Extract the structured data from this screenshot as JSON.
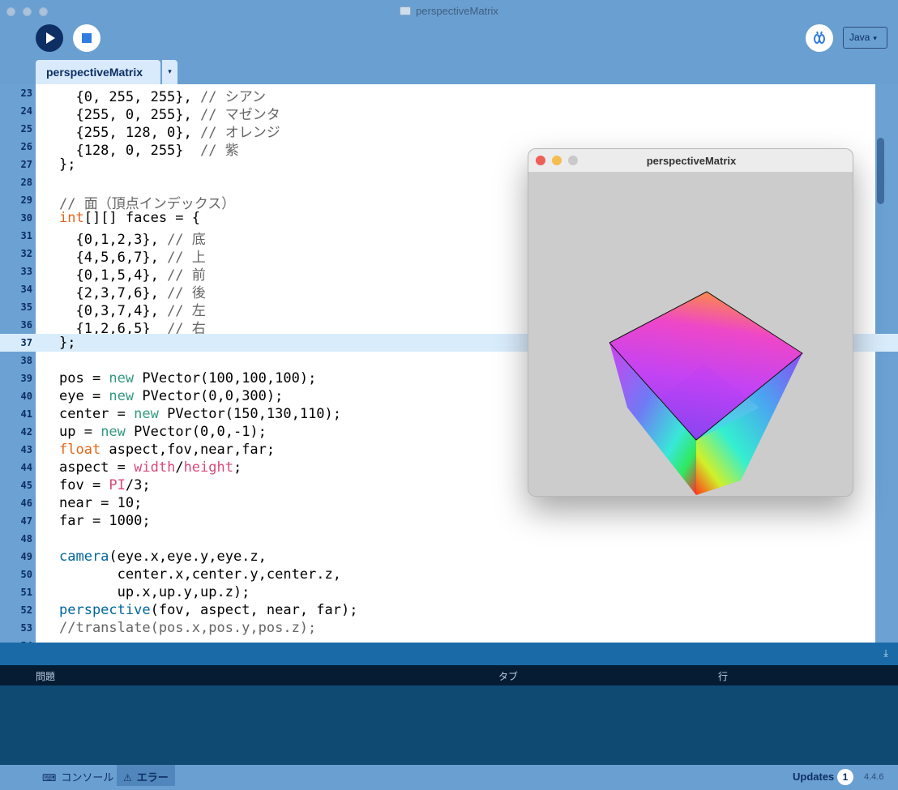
{
  "window": {
    "title": "perspectiveMatrix"
  },
  "toolbar": {
    "run_icon": "play-icon",
    "stop_icon": "stop-icon",
    "debug_icon": "debugger-icon",
    "mode": "Java",
    "mode_arrow": "▾"
  },
  "tabs": [
    {
      "label": "perspectiveMatrix",
      "menu": "▾"
    }
  ],
  "editor": {
    "current_line": "37",
    "lines": [
      {
        "n": "23",
        "segs": [
          {
            "t": "  {0, 255, 255}, ",
            "c": ""
          },
          {
            "t": "// シアン",
            "c": "k-com"
          }
        ]
      },
      {
        "n": "24",
        "segs": [
          {
            "t": "  {255, 0, 255}, ",
            "c": ""
          },
          {
            "t": "// マゼンタ",
            "c": "k-com"
          }
        ]
      },
      {
        "n": "25",
        "segs": [
          {
            "t": "  {255, 128, 0}, ",
            "c": ""
          },
          {
            "t": "// オレンジ",
            "c": "k-com"
          }
        ]
      },
      {
        "n": "26",
        "segs": [
          {
            "t": "  {128, 0, 255}  ",
            "c": ""
          },
          {
            "t": "// 紫",
            "c": "k-com"
          }
        ]
      },
      {
        "n": "27",
        "segs": [
          {
            "t": "};",
            "c": ""
          }
        ]
      },
      {
        "n": "28",
        "segs": []
      },
      {
        "n": "29",
        "segs": [
          {
            "t": "// 面（頂点インデックス）",
            "c": "k-com"
          }
        ]
      },
      {
        "n": "30",
        "segs": [
          {
            "t": "int",
            "c": "k-type"
          },
          {
            "t": "[][] faces = {",
            "c": ""
          }
        ]
      },
      {
        "n": "31",
        "segs": [
          {
            "t": "  {0,1,2,3}, ",
            "c": ""
          },
          {
            "t": "// 底",
            "c": "k-com"
          }
        ]
      },
      {
        "n": "32",
        "segs": [
          {
            "t": "  {4,5,6,7}, ",
            "c": ""
          },
          {
            "t": "// 上",
            "c": "k-com"
          }
        ]
      },
      {
        "n": "33",
        "segs": [
          {
            "t": "  {0,1,5,4}, ",
            "c": ""
          },
          {
            "t": "// 前",
            "c": "k-com"
          }
        ]
      },
      {
        "n": "34",
        "segs": [
          {
            "t": "  {2,3,7,6}, ",
            "c": ""
          },
          {
            "t": "// 後",
            "c": "k-com"
          }
        ]
      },
      {
        "n": "35",
        "segs": [
          {
            "t": "  {0,3,7,4}, ",
            "c": ""
          },
          {
            "t": "// 左",
            "c": "k-com"
          }
        ]
      },
      {
        "n": "36",
        "segs": [
          {
            "t": "  {1,2,6,5}  ",
            "c": ""
          },
          {
            "t": "// 右",
            "c": "k-com"
          }
        ]
      },
      {
        "n": "37",
        "segs": [
          {
            "t": "};",
            "c": ""
          }
        ]
      },
      {
        "n": "38",
        "segs": []
      },
      {
        "n": "39",
        "segs": [
          {
            "t": "pos = ",
            "c": ""
          },
          {
            "t": "new",
            "c": "k-new"
          },
          {
            "t": " PVector(100,100,100);",
            "c": ""
          }
        ]
      },
      {
        "n": "40",
        "segs": [
          {
            "t": "eye = ",
            "c": ""
          },
          {
            "t": "new",
            "c": "k-new"
          },
          {
            "t": " PVector(0,0,300);",
            "c": ""
          }
        ]
      },
      {
        "n": "41",
        "segs": [
          {
            "t": "center = ",
            "c": ""
          },
          {
            "t": "new",
            "c": "k-new"
          },
          {
            "t": " PVector(150,130,110);",
            "c": ""
          }
        ]
      },
      {
        "n": "42",
        "segs": [
          {
            "t": "up = ",
            "c": ""
          },
          {
            "t": "new",
            "c": "k-new"
          },
          {
            "t": " PVector(0,0,-1);",
            "c": ""
          }
        ]
      },
      {
        "n": "43",
        "segs": [
          {
            "t": "float",
            "c": "k-type"
          },
          {
            "t": " aspect,fov,near,far;",
            "c": ""
          }
        ]
      },
      {
        "n": "44",
        "segs": [
          {
            "t": "aspect = ",
            "c": ""
          },
          {
            "t": "width",
            "c": "k-const"
          },
          {
            "t": "/",
            "c": ""
          },
          {
            "t": "height",
            "c": "k-const"
          },
          {
            "t": ";",
            "c": ""
          }
        ]
      },
      {
        "n": "45",
        "segs": [
          {
            "t": "fov = ",
            "c": ""
          },
          {
            "t": "PI",
            "c": "k-const"
          },
          {
            "t": "/3;",
            "c": ""
          }
        ]
      },
      {
        "n": "46",
        "segs": [
          {
            "t": "near = 10;",
            "c": ""
          }
        ]
      },
      {
        "n": "47",
        "segs": [
          {
            "t": "far = 1000;",
            "c": ""
          }
        ]
      },
      {
        "n": "48",
        "segs": []
      },
      {
        "n": "49",
        "segs": [
          {
            "t": "camera",
            "c": "k-fn"
          },
          {
            "t": "(eye.x,eye.y,eye.z,",
            "c": ""
          }
        ]
      },
      {
        "n": "50",
        "segs": [
          {
            "t": "       center.x,center.y,center.z,",
            "c": ""
          }
        ]
      },
      {
        "n": "51",
        "segs": [
          {
            "t": "       up.x,up.y,up.z);",
            "c": ""
          }
        ]
      },
      {
        "n": "52",
        "segs": [
          {
            "t": "perspective",
            "c": "k-fn"
          },
          {
            "t": "(fov, aspect, near, far);",
            "c": ""
          }
        ]
      },
      {
        "n": "53",
        "segs": [
          {
            "t": "//translate(pos.x,pos.y,pos.z);",
            "c": "k-com"
          }
        ]
      },
      {
        "n": "54",
        "segs": [
          {
            "t": "////面",
            "c": "k-com"
          }
        ]
      }
    ]
  },
  "sketch_window": {
    "title": "perspectiveMatrix"
  },
  "error_panel": {
    "columns": [
      "問題",
      "タブ",
      "行"
    ],
    "collapse_icon": "collapse-panel-icon"
  },
  "bottom_tabs": [
    {
      "label": "コンソール",
      "icon": "console-icon",
      "glyph": "⌨"
    },
    {
      "label": "エラー",
      "icon": "warning-icon",
      "glyph": "⚠"
    }
  ],
  "status": {
    "updates_label": "Updates",
    "updates_count": "1",
    "version": "4.4.6"
  }
}
